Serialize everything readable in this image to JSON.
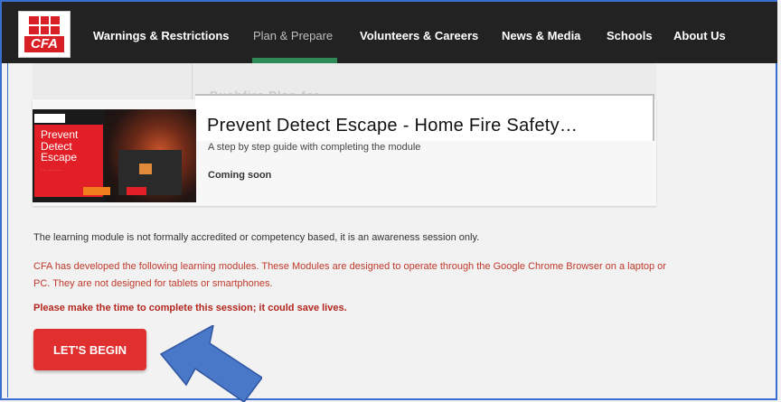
{
  "nav": {
    "logo_text": "CFA",
    "items": [
      "Warnings & Restrictions",
      "Plan & Prepare",
      "Volunteers & Careers",
      "News & Media",
      "Schools",
      "About Us"
    ],
    "active_index": 1,
    "active_color": "#2e8b57"
  },
  "card": {
    "ghost_title": "Bushfire Plan for …",
    "title": "Prevent Detect Escape - Home Fire Safety…",
    "subtitle": "A step by step guide with completing the module",
    "status": "Coming soon",
    "thumbnail_text": "Prevent Detect Escape"
  },
  "info": {
    "accreditation": "The learning module is not formally accredited or competency based, it is an awareness session only.",
    "browser_note": "CFA has developed the following learning modules. These Modules are designed to operate through the Google Chrome Browser on a laptop or PC. They are not designed for tablets or smartphones.",
    "urge": "Please make the time to complete this session; it could save lives."
  },
  "cta": {
    "label": "LET'S BEGIN",
    "color": "#e02f2f"
  },
  "annotation": {
    "icon": "arrow-up-left-icon",
    "color": "#4a78c8"
  }
}
